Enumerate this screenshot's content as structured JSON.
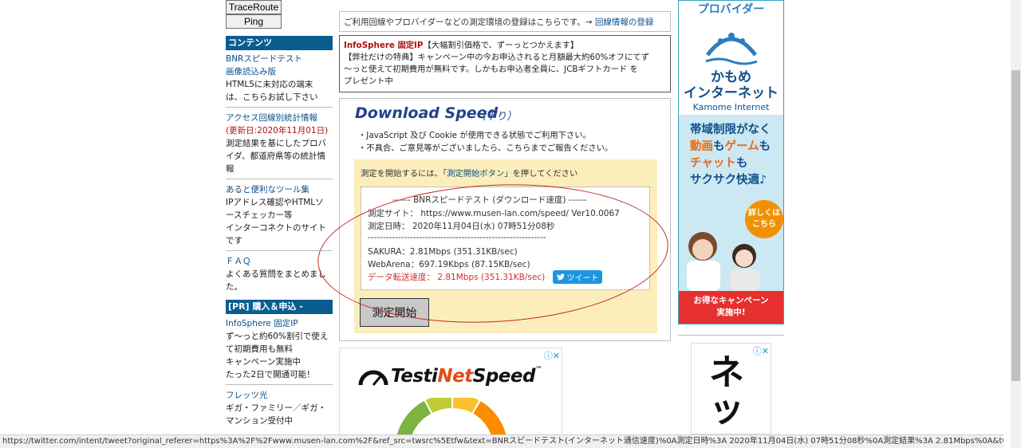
{
  "sidebar": {
    "traceroute": "TraceRoute",
    "ping": "Ping",
    "contents_head": "コンテンツ",
    "bnr_speedtest": "BNRスピードテスト",
    "image_version": "画像読込み版",
    "html5_line1": "HTML5に未対応の端末",
    "html5_line2": "は、こちらお試し下さい",
    "access_stats": "アクセス回線別統計情報",
    "updated": "(更新日:2020年11月01日)",
    "stats_desc1": "測定結果を基にしたプロバ",
    "stats_desc2": "イダ、都道府県等の統計情",
    "stats_desc3": "報",
    "tools": "あると便利なツール集",
    "tools_desc1": "IPアドレス確認やHTMLソ",
    "tools_desc2": "ースチェッカー等",
    "tools_desc3": "インターコネクトのサイト",
    "tools_desc4": "です",
    "faq": "ＦＡＱ",
    "faq_desc1": "よくある質問をまとめまし",
    "faq_desc2": "た。",
    "pr_head": "[PR] 購入＆申込 -",
    "pr1": "InfoSphere 固定IP",
    "pr2": "ず〜っと約60%割引で使え",
    "pr3": "て初期費用も無料",
    "pr4": "キャンペーン実施中",
    "pr5": "たった2日で開通可能！",
    "flets": "フレッツ光",
    "flets2": "ギガ・ファミリー／ギガ・",
    "flets3": "マンション受付中"
  },
  "topbar": {
    "text": "ご利用回線やプロバイダーなどの測定環境の登録はこちらです。→",
    "link": "回線情報の登録"
  },
  "infobox": {
    "title": "InfoSphere 固定IP",
    "title_rest": "【大幅割引価格で、ずーっとつかえます】",
    "line2": "【弊社だけの特典】キャンペーン中の今お申込されると月額最大約60%オフにてず",
    "line3": "〜っと使えて初期費用が無料です。しかもお申込者全員に、JCBギフトカード を",
    "line4": "プレゼント中"
  },
  "panel": {
    "title": "Download Speed",
    "subtitle": "（下り）",
    "bullet1": "・JavaScript 及び Cookie が使用できる状態でご利用下さい。",
    "bullet2": "・不具合、ご意見等がございましたら、こちらまでご報告ください。",
    "instruction": "測定を開始するには、",
    "instruction_link": "「測定開始ボタン」",
    "instruction_end": "を押してください",
    "result_header": "------ BNRスピードテスト (ダウンロード速度) ------",
    "site": "測定サイト： https://www.musen-lan.com/speed/ Ver10.0067",
    "date": "測定日時： 2020年11月04日(水) 07時51分08秒",
    "separator": "-----------------------------------------------------------",
    "sakura": "SAKURA：2.81Mbps (351.31KB/sec)",
    "webarena": "WebArena：697.19Kbps (87.15KB/sec)",
    "transfer": "データ転送速度： 2.81Mbps (351.31KB/sec)",
    "tweet": "ツイート",
    "start": "測定開始"
  },
  "ad2": {
    "logo_part1": "Testi",
    "logo_part2": "Net",
    "logo_part3": "Speed",
    "tm": "™"
  },
  "right_ad": {
    "top": "プロバイダー",
    "brand1": "かもめ",
    "brand2": "インターネット",
    "brand_en": "Kamome Internet",
    "line1": "帯域制限がなく",
    "line2a": "動画",
    "line2b": "も",
    "line2c": "ゲーム",
    "line2d": "も",
    "line3a": "チャット",
    "line3b": "も",
    "line4": "サクサク快適♪",
    "detail1": "詳しくは",
    "detail2": "こちら",
    "campaign1": "お得なキャンペーン",
    "campaign2": "実施中!"
  },
  "right_ad2": {
    "text1": "ネ",
    "text2": "ッ"
  },
  "status_url": "https://twitter.com/intent/tweet?original_referer=https%3A%2F%2Fwww.musen-lan.com%2F&ref_src=twsrc%5Etfw&text=BNRスピードテスト(インターネット通信速度)%0A測定日時%3A 2020年11月04日(水) 07時51分08秒%0A測定結果%3A 2.81Mbps%0A&tw_p=tweetbutton&url=https%3..."
}
